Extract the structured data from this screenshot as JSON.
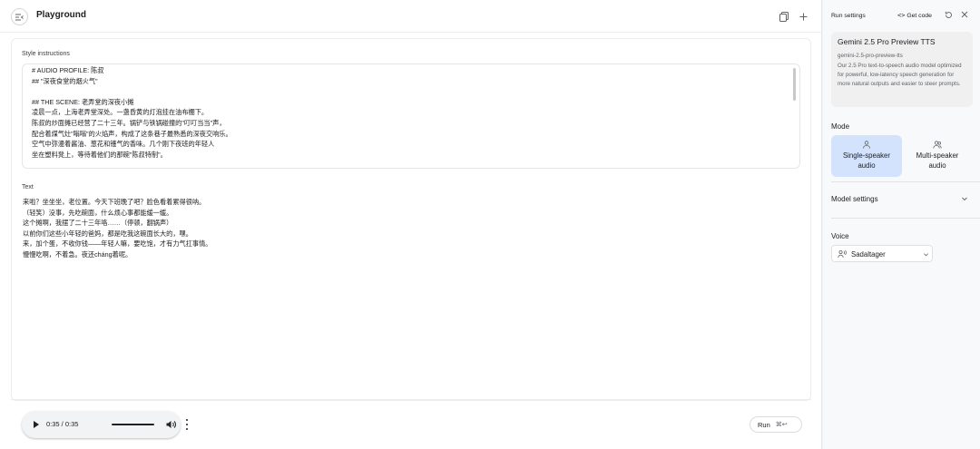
{
  "header": {
    "title": "Playground",
    "icons": [
      "sidebar-toggle-icon",
      "copy-icon",
      "plus-icon"
    ]
  },
  "editor": {
    "style_label": "Style instructions",
    "style_lines": [
      "# AUDIO PROFILE: 陈叔",
      "## \"深夜食堂的烟火气\"",
      "",
      "## THE SCENE: 老弄堂的深夜小摊",
      "凌晨一点，上海老弄堂深处。一盏昏黄的灯泡挂在油布棚下。",
      "陈叔的炒面摊已经营了二十三年。锅铲与铁锅碰撞的\"叮叮当当\"声，",
      "配合着煤气灶\"嗡嗡\"的火焰声，构成了这条巷子最熟悉的深夜交响乐。",
      "空气中弥漫着酱油、葱花和镬气的香味。几个刚下夜班的年轻人",
      "坐在塑料凳上，等待着他们的那碗\"陈叔特制\"。"
    ],
    "text_label": "Text",
    "text_lines": [
      "来啦？坐坐坐，老位置。今天下班晚了吧？脸色看着累得很呐。",
      "（轻笑）没事，先吃碗面，什么烦心事都能缓一缓。",
      "这个摊啊，我摆了二十三年咯……（停顿，翻锅声）",
      "以前你们这些小年轻的爸妈，都是吃我这碗面长大的，嘿。",
      "来，加个蛋，不收你钱——年轻人嘛，要吃饱，才有力气扛事情。",
      "慢慢吃啊，不着急。夜还cháng着呢。"
    ]
  },
  "player": {
    "time": "0:35 / 0:35",
    "progress": 1.0
  },
  "run_button": {
    "label": "Run",
    "shortcut": "⌘↩"
  },
  "panel": {
    "title": "Run settings",
    "get_code": "Get code",
    "model": {
      "name": "Gemini 2.5 Pro Preview TTS",
      "id": "gemini-2.5-pro-preview-tts",
      "description": "Our 2.5 Pro text-to-speech audio model optimized for powerful, low-latency speech generation for more natural outputs and easier to steer prompts."
    },
    "mode_label": "Mode",
    "modes": [
      {
        "label_line1": "Single-speaker",
        "label_line2": "audio",
        "selected": true
      },
      {
        "label_line1": "Multi-speaker",
        "label_line2": "audio",
        "selected": false
      }
    ],
    "model_settings_label": "Model settings",
    "voice_label": "Voice",
    "voice_value": "Sadaltager"
  },
  "colors": {
    "selected_mode_bg": "#d3e3fd",
    "panel_bg": "#f8f9fa",
    "model_card_bg": "#f0f0f0"
  }
}
